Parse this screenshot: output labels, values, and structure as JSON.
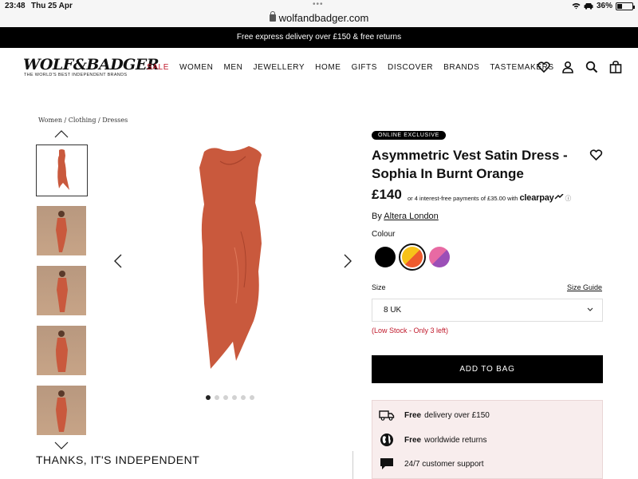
{
  "status_bar": {
    "time": "23:48",
    "date": "Thu 25 Apr",
    "dots": "•••",
    "url": "wolfandbadger.com",
    "battery": "36%",
    "battery_level": 0.36
  },
  "promo": {
    "text": "Free express delivery over £150 & free returns"
  },
  "brand": {
    "logo": "WOLF&BADGER",
    "tagline": "THE WORLD'S BEST INDEPENDENT BRANDS"
  },
  "nav": {
    "items": [
      "SALE",
      "WOMEN",
      "MEN",
      "JEWELLERY",
      "HOME",
      "GIFTS",
      "DISCOVER",
      "BRANDS",
      "TASTEMAKERS"
    ]
  },
  "breadcrumb": "Women / Clothing / Dresses",
  "gallery": {
    "thumb_count": 5,
    "selected_index": 0,
    "pager_count": 6,
    "pager_active": 0
  },
  "thanks": "THANKS, IT'S INDEPENDENT",
  "product": {
    "badge": "ONLINE EXCLUSIVE",
    "title": "Asymmetric Vest Satin Dress - Sophia In Burnt Orange",
    "price": "£140",
    "installments": "or 4 interest-free payments of £35.00 with",
    "clearpay": "clearpay",
    "info_icon": "ⓘ",
    "by_label": "By",
    "brand": "Altera London",
    "colour_label": "Colour",
    "swatches": [
      {
        "name": "black",
        "colors": [
          "#000000",
          "#000000"
        ]
      },
      {
        "name": "orange-yellow",
        "colors": [
          "#f7c21a",
          "#ee5b2e"
        ]
      },
      {
        "name": "pink-purple",
        "colors": [
          "#e86aa3",
          "#9b4fb7"
        ]
      }
    ],
    "selected_swatch": 1,
    "size_label": "Size",
    "size_guide": "Size Guide",
    "size_value": "8 UK",
    "stock": "(Low Stock - Only 3 left)",
    "add_to_bag": "ADD TO BAG",
    "dress_color": "#c9593d"
  },
  "benefits": [
    {
      "icon": "truck-icon",
      "bold": "Free",
      "text": "delivery over £150"
    },
    {
      "icon": "globe-icon",
      "bold": "Free",
      "text": "worldwide returns"
    },
    {
      "icon": "chat-bubble-icon",
      "bold": "",
      "text": "24/7 customer support"
    }
  ]
}
